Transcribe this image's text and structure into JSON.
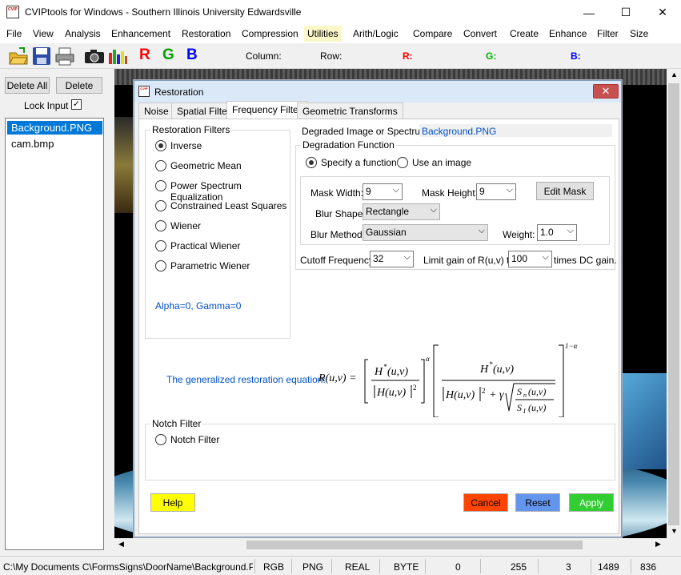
{
  "app": {
    "title": "CVIPtools for Windows - Southern Illinois University Edwardsville",
    "icon_label": "CVIP",
    "minimize": "—",
    "maximize": "☐",
    "close": "✕"
  },
  "menu": [
    "File",
    "View",
    "Analysis",
    "Enhancement",
    "Restoration",
    "Compression",
    "Utilities",
    "Arith/Logic",
    "Compare",
    "Convert",
    "Create",
    "Enhance",
    "Filter",
    "Size"
  ],
  "toolbar": {
    "column_label": "Column:",
    "row_label": "Row:",
    "r_label": "R:",
    "g_label": "G:",
    "b_label": "B:",
    "r_button": "R",
    "g_button": "G",
    "b_button": "B",
    "colors": {
      "r": "#ff0000",
      "g": "#00a000",
      "b": "#0000ff"
    }
  },
  "left_panel": {
    "delete_all": "Delete All",
    "delete": "Delete",
    "lock_input": "Lock Input",
    "lock_input_checked": true,
    "files": [
      {
        "name": "Background.PNG",
        "selected": true
      },
      {
        "name": "cam.bmp",
        "selected": false
      }
    ]
  },
  "dialog": {
    "title": "Restoration",
    "icon_label": "CVIP",
    "close": "✕",
    "tabs": [
      "Noise",
      "Spatial Filter",
      "Frequency Filter",
      "Geometric Transforms"
    ],
    "active_tab": "Frequency Filter",
    "restoration_filters": {
      "title": "Restoration Filters",
      "options": [
        "Inverse",
        "Geometric Mean",
        "Power Spectrum Equalization",
        "Constrained Least Squares",
        "Wiener",
        "Practical Wiener",
        "Parametric Wiener"
      ],
      "selected": "Inverse",
      "params_note": "Alpha=0, Gamma=0"
    },
    "degraded_label": "Degraded Image or Spectrum:",
    "degraded_value": "Background.PNG",
    "degradation_function": {
      "title": "Degradation Function",
      "specify": "Specify a function",
      "use_image": "Use an image",
      "selected": "Specify a function",
      "mask_width_label": "Mask Width:",
      "mask_width": "9",
      "mask_height_label": "Mask Height:",
      "mask_height": "9",
      "edit_mask": "Edit Mask",
      "blur_shape_label": "Blur Shape:",
      "blur_shape": "Rectangle",
      "blur_method_label": "Blur Method:",
      "blur_method": "Gaussian",
      "weight_label": "Weight:",
      "weight": "1.0"
    },
    "cutoff_label": "Cutoff Frequency",
    "cutoff_value": "32",
    "limit_label": "Limit gain of R(u,v) to",
    "limit_value": "100",
    "limit_suffix": "times DC gain.",
    "equation_label": "The generalized  restoration equation:",
    "notch": {
      "title": "Notch Filter",
      "option": "Notch Filter"
    },
    "buttons": {
      "help": "Help",
      "cancel": "Cancel",
      "reset": "Reset",
      "apply": "Apply"
    },
    "colors": {
      "help": "#ffff00",
      "cancel": "#ff4500",
      "reset": "#6495ed",
      "apply": "#32cd32",
      "link": "#0050c8"
    }
  },
  "status": [
    "C:\\My Documents C\\FormsSigns\\DoorName\\Background.PNG",
    "RGB",
    "PNG",
    "REAL",
    "BYTE",
    "0",
    "255",
    "3",
    "1489",
    "836"
  ]
}
